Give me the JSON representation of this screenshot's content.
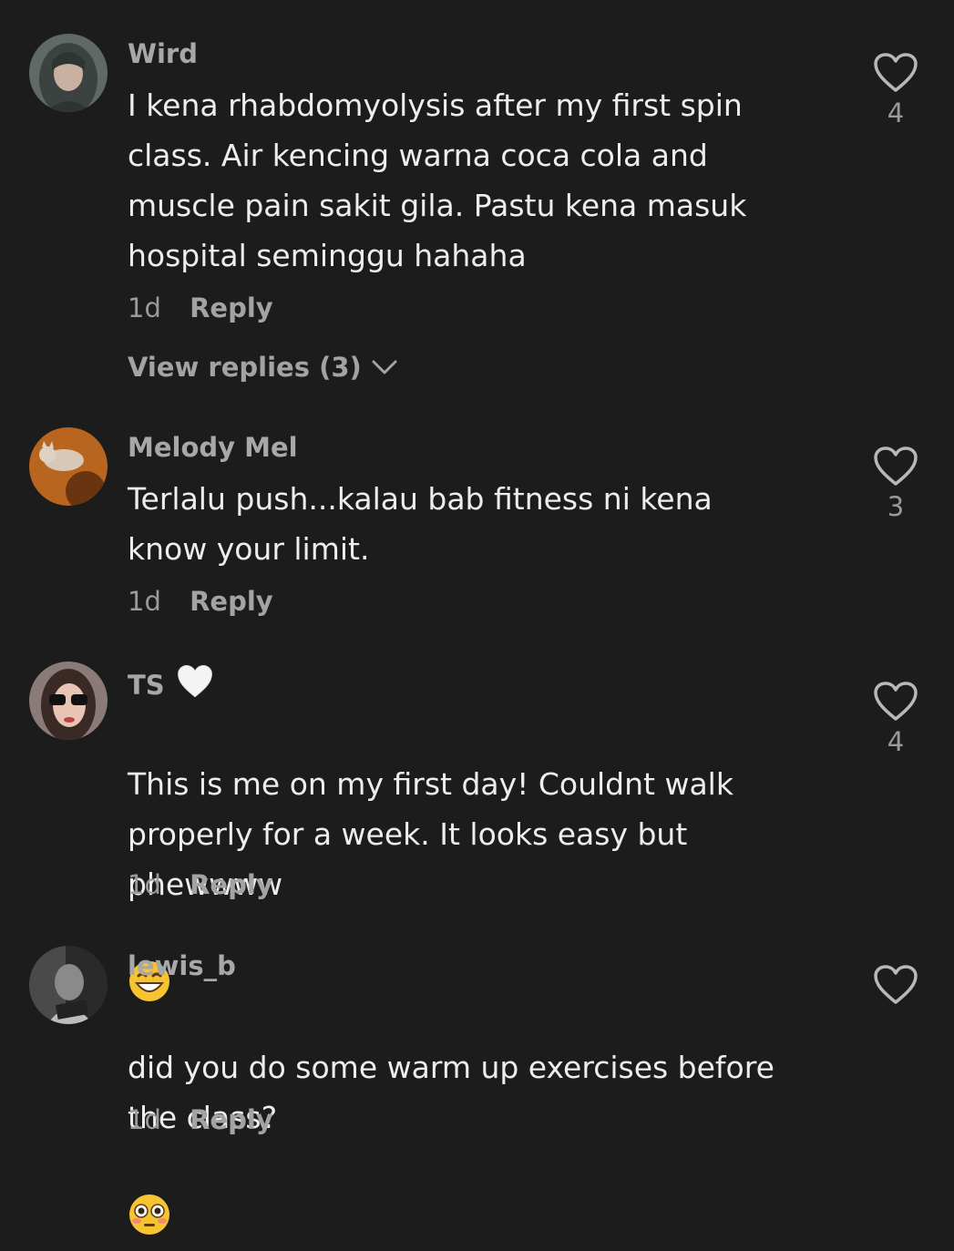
{
  "comments": [
    {
      "username": "Wird",
      "text": "I kena rhabdomyolysis after my first spin\nclass. Air kencing warna coca cola and\nmuscle pain sakit gila. Pastu kena masuk\nhospital seminggu hahaha",
      "time": "1d",
      "reply_label": "Reply",
      "likes": "4",
      "view_replies": "View replies (3)",
      "avatar_icon": "avatar-photo-hijab"
    },
    {
      "username": "Melody Mel",
      "text": "Terlalu push...kalau bab fitness ni kena\nknow your limit.",
      "time": "1d",
      "reply_label": "Reply",
      "likes": "3",
      "avatar_icon": "avatar-photo-cat"
    },
    {
      "username": "TS",
      "username_icon": "white-heart-emoji",
      "text_line1": "This is me on my first day! Couldnt walk\nproperly for a week. It looks easy but\n",
      "text_line2": "phewwww",
      "text_emoji": "grinning-face-with-sweat-emoji",
      "time": "1d",
      "reply_label": "Reply",
      "likes": "4",
      "avatar_icon": "avatar-photo-sunglasses"
    },
    {
      "username": "lewis_b",
      "text_line1": "did you do some warm up exercises before\n",
      "text_line2": "the class?",
      "text_emoji": "flushed-face-emoji",
      "time": "1d",
      "reply_label": "Reply",
      "likes": "",
      "avatar_icon": "avatar-photo-laptop"
    }
  ],
  "colors": {
    "background": "#1c1c1c",
    "text": "#ededed",
    "secondary": "#a3a3a3"
  }
}
